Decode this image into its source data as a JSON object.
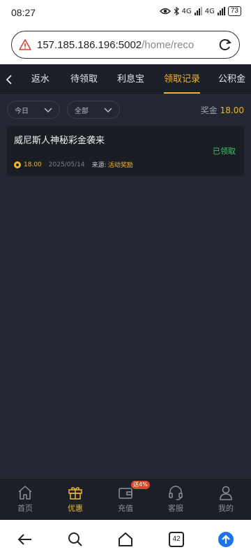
{
  "status": {
    "time": "08:27",
    "net1": "4G",
    "net2": "4G",
    "battery": "73"
  },
  "browser": {
    "url_host": "157.185.186.196:5002",
    "url_path": "/home/reco",
    "tab_count": "42"
  },
  "tabs": [
    {
      "label": "返水"
    },
    {
      "label": "待领取"
    },
    {
      "label": "利息宝"
    },
    {
      "label": "领取记录"
    },
    {
      "label": "公积金"
    }
  ],
  "filters": {
    "date": "今日",
    "type": "全部",
    "bonus_label": "奖金",
    "bonus_amount": "18.00"
  },
  "records": [
    {
      "title": "威尼斯人神秘彩金袭来",
      "status": "已领取",
      "amount": "18.00",
      "date": "2025/05/14",
      "source_label": "来源:",
      "source": "活动奖励"
    }
  ],
  "bottom_nav": [
    {
      "label": "首页",
      "icon": "home-icon"
    },
    {
      "label": "优惠",
      "icon": "gift-icon"
    },
    {
      "label": "充值",
      "icon": "wallet-icon",
      "badge": "送4%"
    },
    {
      "label": "客服",
      "icon": "headset-icon"
    },
    {
      "label": "我的",
      "icon": "user-icon"
    }
  ],
  "colors": {
    "accent": "#f0b62f",
    "success": "#3cc36a",
    "bg": "#232731",
    "badge": "#e0452c"
  }
}
